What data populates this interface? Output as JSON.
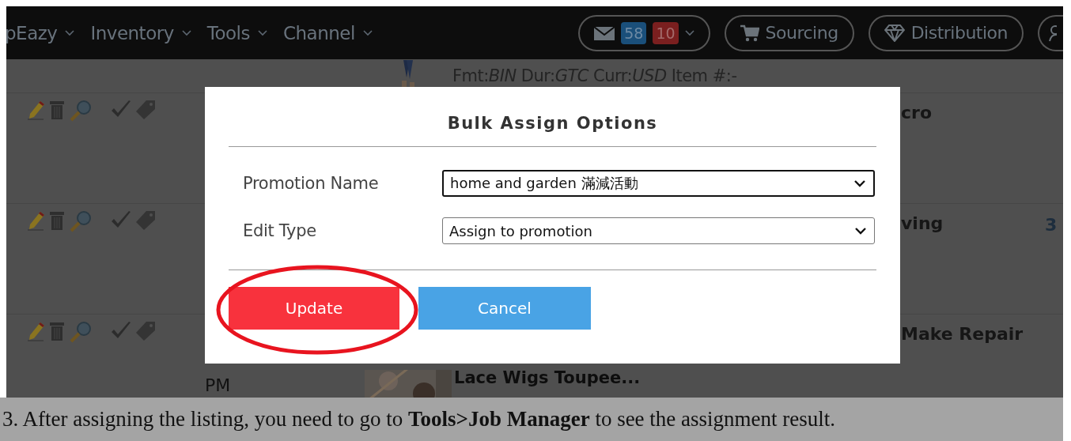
{
  "nav": {
    "menus": [
      {
        "label": "pEazy"
      },
      {
        "label": "Inventory"
      },
      {
        "label": "Tools"
      },
      {
        "label": "Channel"
      }
    ],
    "message_counts": [
      {
        "count": "58",
        "color": "#1a4f7a"
      },
      {
        "count": "10",
        "color": "#7a1f1f"
      }
    ],
    "buttons": [
      {
        "label": "Sourcing",
        "kind": "cart"
      },
      {
        "label": "Distribution",
        "kind": "diamond"
      },
      {
        "kind": "partial"
      }
    ]
  },
  "top_row": {
    "details": "Fmt:*BIN* Dur:*GTC* Curr:*USD* Item #:-"
  },
  "rows": [
    {
      "title": "cro"
    },
    {
      "title": "ving",
      "extra": "3"
    },
    {
      "title": "Make Repair",
      "time": "PM",
      "subtitle": "Lace Wigs Toupee..."
    }
  ],
  "modal": {
    "title": "Bulk Assign Options",
    "fields": [
      {
        "label": "Promotion Name",
        "value": "home and garden 滿減活動",
        "focused": true
      },
      {
        "label": "Edit Type",
        "value": "Assign to promotion",
        "focused": false
      }
    ],
    "buttons": [
      {
        "label": "Update",
        "kind": "primary",
        "highlighted": true
      },
      {
        "label": "Cancel",
        "kind": "secondary",
        "highlighted": false
      }
    ]
  },
  "caption": "3. After assigning the listing, you need to go to **Tools>Job Manager** to see the assignment result."
}
